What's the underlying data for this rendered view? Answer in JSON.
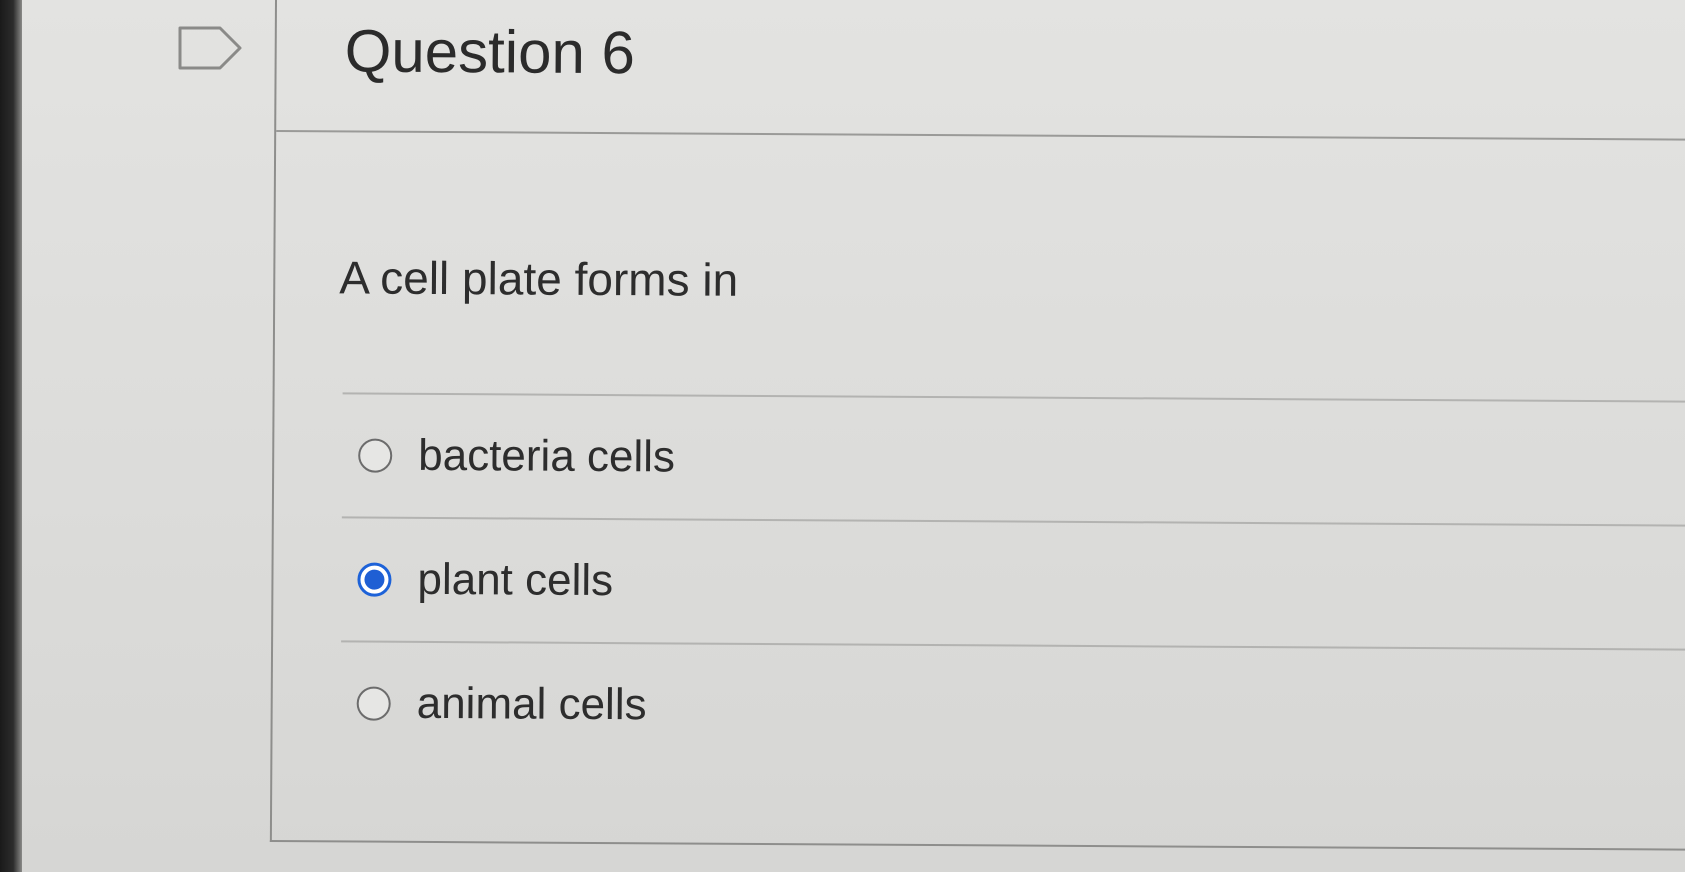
{
  "question": {
    "title": "Question 6",
    "text": "A cell plate forms in",
    "options": [
      {
        "label": "bacteria cells",
        "selected": false
      },
      {
        "label": "plant cells",
        "selected": true
      },
      {
        "label": "animal cells",
        "selected": false
      }
    ]
  },
  "icons": {
    "flag": "flag-question-icon"
  },
  "colors": {
    "accent": "#1f5fd4",
    "background": "#dcdcda",
    "text": "#2d2d2d"
  }
}
